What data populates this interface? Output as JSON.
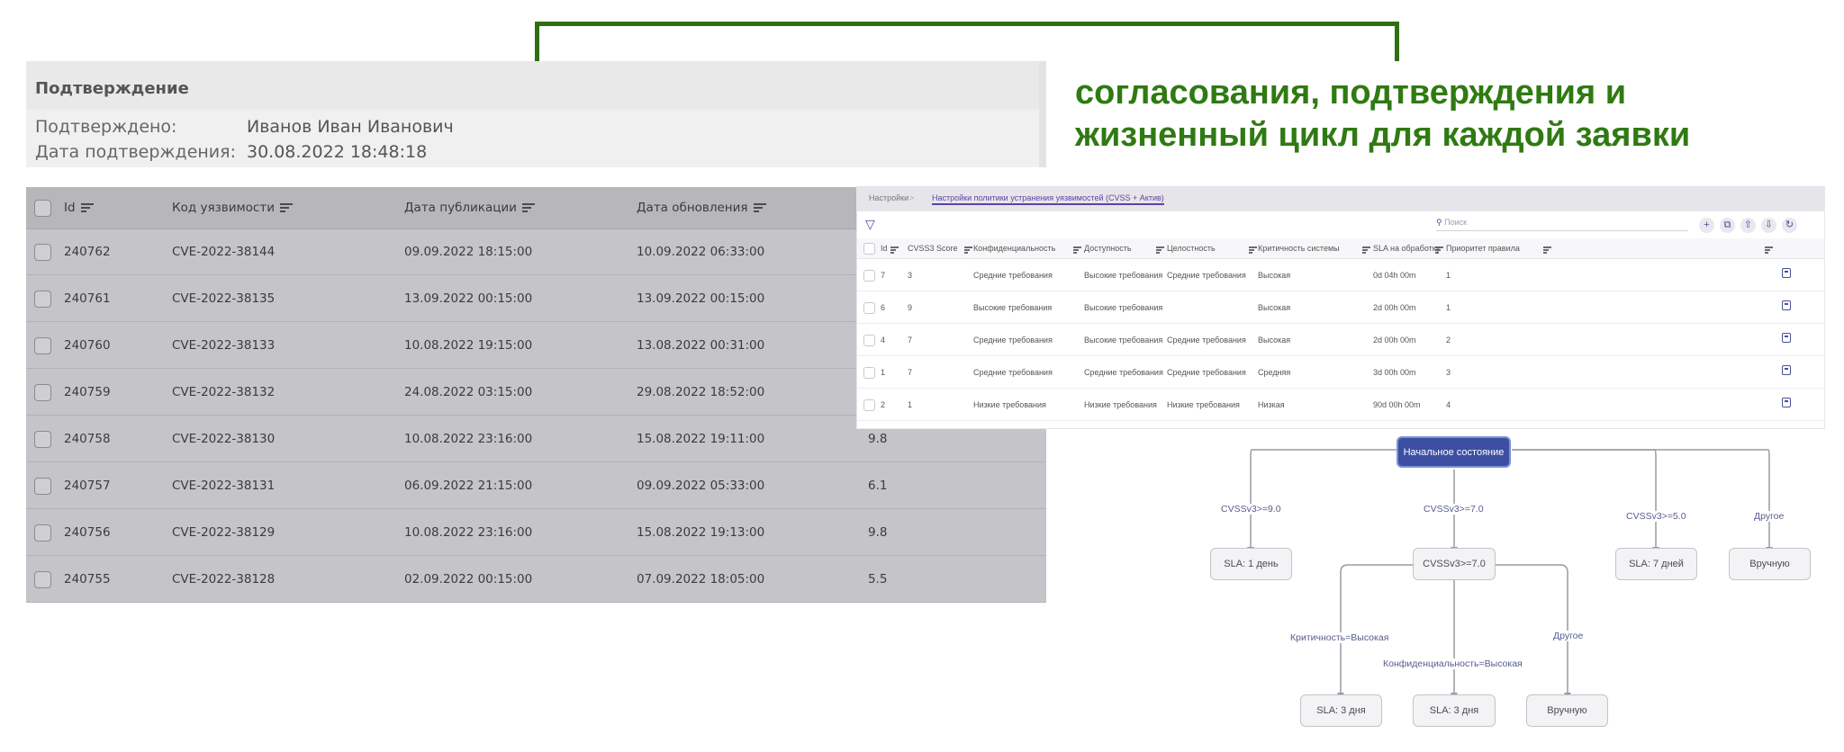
{
  "callout": {
    "text_line1": "согласования, подтверждения и",
    "text_line2": "жизненный цикл для каждой заявки",
    "color": "#2f7a12"
  },
  "confirmation": {
    "title": "Подтверждение",
    "confirmed_by_label": "Подтверждено:",
    "confirmed_by_value": "Иванов Иван Иванович",
    "date_label": "Дата подтверждения:",
    "date_value": "30.08.2022 18:48:18"
  },
  "vuln_table": {
    "columns": [
      "Id",
      "Код уязвимости",
      "Дата публикации",
      "Дата обновления"
    ],
    "rows": [
      {
        "id": "240762",
        "code": "CVE-2022-38144",
        "published": "09.09.2022 18:15:00",
        "updated": "10.09.2022 06:33:00",
        "score": ""
      },
      {
        "id": "240761",
        "code": "CVE-2022-38135",
        "published": "13.09.2022 00:15:00",
        "updated": "13.09.2022 00:15:00",
        "score": ""
      },
      {
        "id": "240760",
        "code": "CVE-2022-38133",
        "published": "10.08.2022 19:15:00",
        "updated": "13.08.2022 00:31:00",
        "score": ""
      },
      {
        "id": "240759",
        "code": "CVE-2022-38132",
        "published": "24.08.2022 03:15:00",
        "updated": "29.08.2022 18:52:00",
        "score": ""
      },
      {
        "id": "240758",
        "code": "CVE-2022-38130",
        "published": "10.08.2022 23:16:00",
        "updated": "15.08.2022 19:11:00",
        "score": "9.8"
      },
      {
        "id": "240757",
        "code": "CVE-2022-38131",
        "published": "06.09.2022 21:15:00",
        "updated": "09.09.2022 05:33:00",
        "score": "6.1"
      },
      {
        "id": "240756",
        "code": "CVE-2022-38129",
        "published": "10.08.2022 23:16:00",
        "updated": "15.08.2022 19:13:00",
        "score": "9.8"
      },
      {
        "id": "240755",
        "code": "CVE-2022-38128",
        "published": "02.09.2022 00:15:00",
        "updated": "07.09.2022 18:05:00",
        "score": "5.5"
      }
    ]
  },
  "policy": {
    "breadcrumb_root": "Настройки",
    "breadcrumb_sep": ">",
    "breadcrumb_current": "Настройки политики устранения уязвимостей (CVSS + Актив)",
    "search_placeholder": "Поиск",
    "toolbar_icons": [
      "add-icon",
      "copy-icon",
      "export-icon",
      "import-icon",
      "refresh-icon"
    ],
    "add_glyph": "+",
    "copy_glyph": "⧉",
    "export_glyph": "⇧",
    "import_glyph": "⇩",
    "refresh_glyph": "↻",
    "filter_glyph": "▽",
    "search_glyph": "⚲",
    "columns": [
      "Id",
      "CVSS3 Score",
      "Конфиденциальность",
      "Доступность",
      "Целостность",
      "Критичность системы",
      "SLA на обработку",
      "Приоритет правила"
    ],
    "rows": [
      {
        "id": "7",
        "score": "3",
        "conf": "Средние требования",
        "avail": "Высокие требования",
        "integ": "Средние требования",
        "crit": "Высокая",
        "sla": "0d 04h 00m",
        "prio": "1"
      },
      {
        "id": "6",
        "score": "9",
        "conf": "Высокие требования",
        "avail": "Высокие требования",
        "integ": "",
        "crit": "Высокая",
        "sla": "2d 00h 00m",
        "prio": "1"
      },
      {
        "id": "4",
        "score": "7",
        "conf": "Средние требования",
        "avail": "Высокие требования",
        "integ": "Средние требования",
        "crit": "Высокая",
        "sla": "2d 00h 00m",
        "prio": "2"
      },
      {
        "id": "1",
        "score": "7",
        "conf": "Средние требования",
        "avail": "Средние требования",
        "integ": "Средние требования",
        "crit": "Средняя",
        "sla": "3d 00h 00m",
        "prio": "3"
      },
      {
        "id": "2",
        "score": "1",
        "conf": "Низкие требования",
        "avail": "Низкие требования",
        "integ": "Низкие требования",
        "crit": "Низкая",
        "sla": "90d 00h 00m",
        "prio": "4"
      }
    ]
  },
  "flow": {
    "root": "Начальное состояние",
    "edge_cvss9": "CVSSv3>=9.0",
    "edge_cvss7": "CVSSv3>=7.0",
    "edge_cvss5": "CVSSv3>=5.0",
    "edge_other1": "Другое",
    "node_sla1": "SLA: 1 день",
    "node_cvss7": "CVSSv3>=7.0",
    "node_sla7": "SLA: 7 дней",
    "node_manual1": "Вручную",
    "edge_crit": "Критичность=Высокая",
    "edge_conf": "Конфиденциальность=Высокая",
    "edge_other2": "Другое",
    "node_sla3a": "SLA: 3 дня",
    "node_sla3b": "SLA: 3 дня",
    "node_manual2": "Вручную"
  }
}
